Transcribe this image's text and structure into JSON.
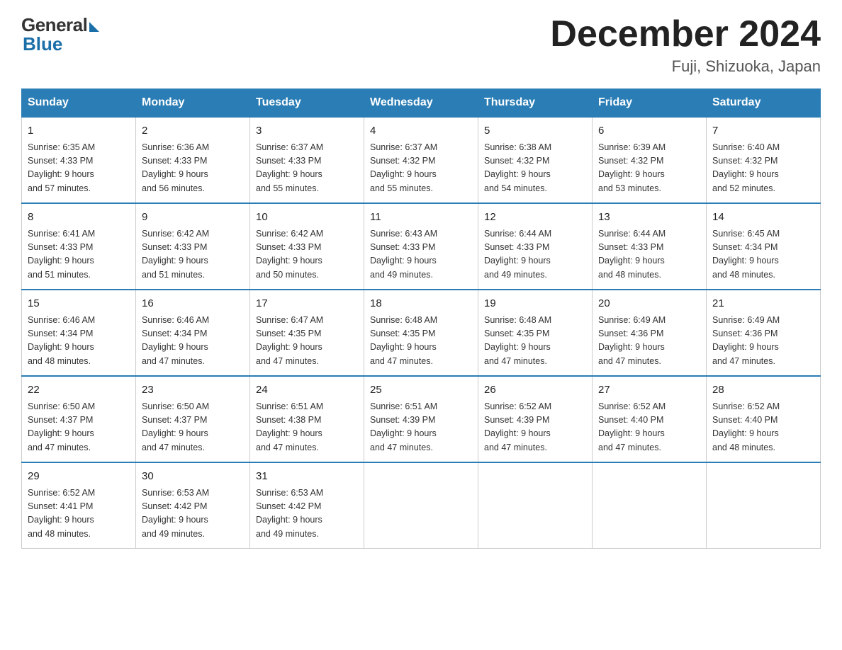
{
  "header": {
    "logo_general": "General",
    "logo_blue": "Blue",
    "month_title": "December 2024",
    "location": "Fuji, Shizuoka, Japan"
  },
  "weekdays": [
    "Sunday",
    "Monday",
    "Tuesday",
    "Wednesday",
    "Thursday",
    "Friday",
    "Saturday"
  ],
  "weeks": [
    [
      {
        "day": "1",
        "sunrise": "6:35 AM",
        "sunset": "4:33 PM",
        "daylight": "9 hours and 57 minutes."
      },
      {
        "day": "2",
        "sunrise": "6:36 AM",
        "sunset": "4:33 PM",
        "daylight": "9 hours and 56 minutes."
      },
      {
        "day": "3",
        "sunrise": "6:37 AM",
        "sunset": "4:33 PM",
        "daylight": "9 hours and 55 minutes."
      },
      {
        "day": "4",
        "sunrise": "6:37 AM",
        "sunset": "4:32 PM",
        "daylight": "9 hours and 55 minutes."
      },
      {
        "day": "5",
        "sunrise": "6:38 AM",
        "sunset": "4:32 PM",
        "daylight": "9 hours and 54 minutes."
      },
      {
        "day": "6",
        "sunrise": "6:39 AM",
        "sunset": "4:32 PM",
        "daylight": "9 hours and 53 minutes."
      },
      {
        "day": "7",
        "sunrise": "6:40 AM",
        "sunset": "4:32 PM",
        "daylight": "9 hours and 52 minutes."
      }
    ],
    [
      {
        "day": "8",
        "sunrise": "6:41 AM",
        "sunset": "4:33 PM",
        "daylight": "9 hours and 51 minutes."
      },
      {
        "day": "9",
        "sunrise": "6:42 AM",
        "sunset": "4:33 PM",
        "daylight": "9 hours and 51 minutes."
      },
      {
        "day": "10",
        "sunrise": "6:42 AM",
        "sunset": "4:33 PM",
        "daylight": "9 hours and 50 minutes."
      },
      {
        "day": "11",
        "sunrise": "6:43 AM",
        "sunset": "4:33 PM",
        "daylight": "9 hours and 49 minutes."
      },
      {
        "day": "12",
        "sunrise": "6:44 AM",
        "sunset": "4:33 PM",
        "daylight": "9 hours and 49 minutes."
      },
      {
        "day": "13",
        "sunrise": "6:44 AM",
        "sunset": "4:33 PM",
        "daylight": "9 hours and 48 minutes."
      },
      {
        "day": "14",
        "sunrise": "6:45 AM",
        "sunset": "4:34 PM",
        "daylight": "9 hours and 48 minutes."
      }
    ],
    [
      {
        "day": "15",
        "sunrise": "6:46 AM",
        "sunset": "4:34 PM",
        "daylight": "9 hours and 48 minutes."
      },
      {
        "day": "16",
        "sunrise": "6:46 AM",
        "sunset": "4:34 PM",
        "daylight": "9 hours and 47 minutes."
      },
      {
        "day": "17",
        "sunrise": "6:47 AM",
        "sunset": "4:35 PM",
        "daylight": "9 hours and 47 minutes."
      },
      {
        "day": "18",
        "sunrise": "6:48 AM",
        "sunset": "4:35 PM",
        "daylight": "9 hours and 47 minutes."
      },
      {
        "day": "19",
        "sunrise": "6:48 AM",
        "sunset": "4:35 PM",
        "daylight": "9 hours and 47 minutes."
      },
      {
        "day": "20",
        "sunrise": "6:49 AM",
        "sunset": "4:36 PM",
        "daylight": "9 hours and 47 minutes."
      },
      {
        "day": "21",
        "sunrise": "6:49 AM",
        "sunset": "4:36 PM",
        "daylight": "9 hours and 47 minutes."
      }
    ],
    [
      {
        "day": "22",
        "sunrise": "6:50 AM",
        "sunset": "4:37 PM",
        "daylight": "9 hours and 47 minutes."
      },
      {
        "day": "23",
        "sunrise": "6:50 AM",
        "sunset": "4:37 PM",
        "daylight": "9 hours and 47 minutes."
      },
      {
        "day": "24",
        "sunrise": "6:51 AM",
        "sunset": "4:38 PM",
        "daylight": "9 hours and 47 minutes."
      },
      {
        "day": "25",
        "sunrise": "6:51 AM",
        "sunset": "4:39 PM",
        "daylight": "9 hours and 47 minutes."
      },
      {
        "day": "26",
        "sunrise": "6:52 AM",
        "sunset": "4:39 PM",
        "daylight": "9 hours and 47 minutes."
      },
      {
        "day": "27",
        "sunrise": "6:52 AM",
        "sunset": "4:40 PM",
        "daylight": "9 hours and 47 minutes."
      },
      {
        "day": "28",
        "sunrise": "6:52 AM",
        "sunset": "4:40 PM",
        "daylight": "9 hours and 48 minutes."
      }
    ],
    [
      {
        "day": "29",
        "sunrise": "6:52 AM",
        "sunset": "4:41 PM",
        "daylight": "9 hours and 48 minutes."
      },
      {
        "day": "30",
        "sunrise": "6:53 AM",
        "sunset": "4:42 PM",
        "daylight": "9 hours and 49 minutes."
      },
      {
        "day": "31",
        "sunrise": "6:53 AM",
        "sunset": "4:42 PM",
        "daylight": "9 hours and 49 minutes."
      },
      null,
      null,
      null,
      null
    ]
  ],
  "labels": {
    "sunrise": "Sunrise:",
    "sunset": "Sunset:",
    "daylight": "Daylight:"
  }
}
